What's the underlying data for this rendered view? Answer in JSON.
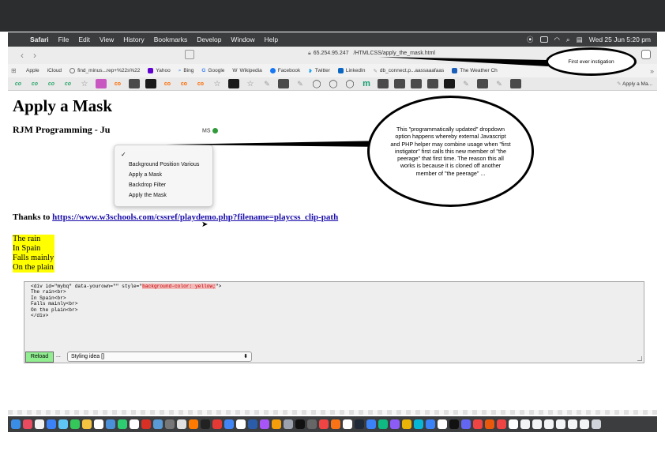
{
  "menubar": {
    "items": [
      "Safari",
      "File",
      "Edit",
      "View",
      "History",
      "Bookmarks",
      "Develop",
      "Window",
      "Help"
    ],
    "clock": "Wed 25 Jun  5:20 pm"
  },
  "browser": {
    "address_host": "65.254.95.247",
    "address_path": "/HTMLCSS/apply_the_mask.html",
    "favourites": [
      "Apple",
      "iCloud",
      "find_minus...rep+%22s%22",
      "Yahoo",
      "Bing",
      "Google",
      "Wikipedia",
      "Facebook",
      "Twitter",
      "LinkedIn",
      "db_connect.p...aassaaafaas",
      "The Weather Ch"
    ],
    "toolbar_last": "Apply a Ma..."
  },
  "page": {
    "title": "Apply a Mask",
    "byline": "RJM Programming - Ju",
    "byline_tail": "MS",
    "thanks_prefix": "Thanks to ",
    "thanks_link": "https://www.w3schools.com/cssref/playdemo.php?filename=playcss_clip-path",
    "poem": [
      "The rain",
      "In Spain",
      "Falls mainly",
      "On the plain"
    ],
    "code_pre": "<div id=\"mybq\" data-yourown=\"\" style=\"",
    "code_highlight": "background-color: yellow;",
    "code_post": "\">",
    "code_rest": "The rain<br>\nIn Spain<br>\nFalls mainly<br>\nOn the plain<br>\n</div>",
    "reload_label": "Reload",
    "dots": "...",
    "select_value": "Styling idea []"
  },
  "dropdown": {
    "options": [
      "Background Position Various",
      "Apply a Mask",
      "Backdrop Filter",
      "Apply the Mask"
    ]
  },
  "annotations": {
    "top": "First ever instigation",
    "main": "This \"programmatically updated\" dropdown option happens whereby external Javascript and PHP helper may combine usage when \"first instigator\" first calls this new member of \"the peerage\" that first time.  The reason this all works is because it is cloned off another member of \"the peerage\" ..."
  },
  "colors": {
    "highlight": "#ffff00",
    "reload_bg": "#90ee90",
    "link": "#1a0dab",
    "menubar": "#3a3c3d"
  }
}
